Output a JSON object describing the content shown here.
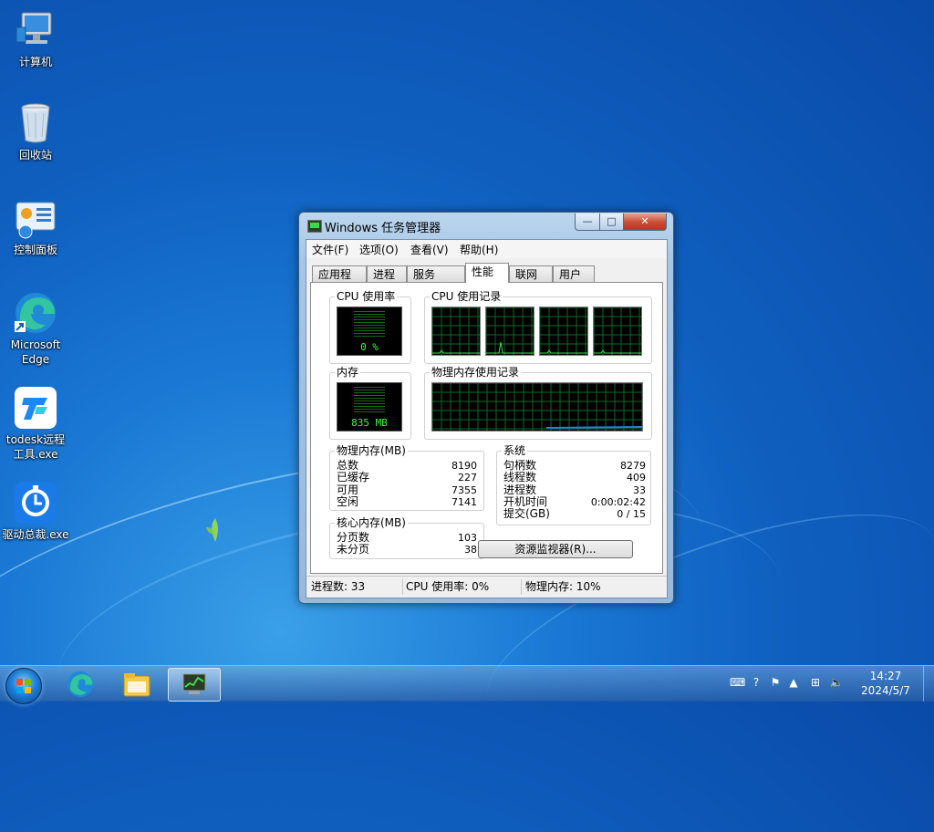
{
  "desktop": {
    "icons": [
      {
        "label": "计算机",
        "icon": "computer-icon"
      },
      {
        "label": "回收站",
        "icon": "recycle-bin-icon"
      },
      {
        "label": "控制面板",
        "icon": "control-panel-icon"
      },
      {
        "label": "Microsoft Edge",
        "icon": "edge-icon"
      },
      {
        "label": "todesk远程工具.exe",
        "icon": "todesk-icon"
      },
      {
        "label": "驱动总裁.exe",
        "icon": "driver-tool-icon"
      }
    ]
  },
  "window": {
    "title": "Windows 任务管理器",
    "controls": {
      "minimize": "—",
      "maximize": "□",
      "close": "✕"
    },
    "menu": [
      "文件(F)",
      "选项(O)",
      "查看(V)",
      "帮助(H)"
    ],
    "tabs": [
      "应用程序",
      "进程",
      "服务",
      "性能",
      "联网",
      "用户"
    ],
    "active_tab": "性能",
    "performance": {
      "cpu_usage_label": "CPU 使用率",
      "cpu_usage_value": "0 %",
      "cpu_history_label": "CPU 使用记录",
      "memory_label": "内存",
      "memory_value": "835 MB",
      "memory_history_label": "物理内存使用记录",
      "physical_memory": {
        "label": "物理内存(MB)",
        "rows": [
          {
            "k": "总数",
            "v": "8190"
          },
          {
            "k": "已缓存",
            "v": "227"
          },
          {
            "k": "可用",
            "v": "7355"
          },
          {
            "k": "空闲",
            "v": "7141"
          }
        ]
      },
      "kernel_memory": {
        "label": "核心内存(MB)",
        "rows": [
          {
            "k": "分页数",
            "v": "103"
          },
          {
            "k": "未分页",
            "v": "38"
          }
        ]
      },
      "system": {
        "label": "系统",
        "rows": [
          {
            "k": "句柄数",
            "v": "8279"
          },
          {
            "k": "线程数",
            "v": "409"
          },
          {
            "k": "进程数",
            "v": "33"
          },
          {
            "k": "开机时间",
            "v": "0:00:02:42"
          },
          {
            "k": "提交(GB)",
            "v": "0 / 15"
          }
        ]
      },
      "resource_monitor_button": "资源监视器(R)...",
      "memory_usage_fraction": 0.1
    },
    "status": {
      "processes": "进程数: 33",
      "cpu": "CPU 使用率: 0%",
      "memory": "物理内存: 10%"
    }
  },
  "taskbar": {
    "pinned": [
      "edge-icon",
      "explorer-icon",
      "task-manager-icon"
    ],
    "tray_icons": [
      "keyboard-icon",
      "help-icon",
      "security-icon",
      "show-hidden-icon",
      "network-icon",
      "volume-icon"
    ],
    "time": "14:27",
    "date": "2024/5/7"
  },
  "colors": {
    "graph_green": "#3adb48",
    "memory_blue": "#2a7ed8"
  }
}
